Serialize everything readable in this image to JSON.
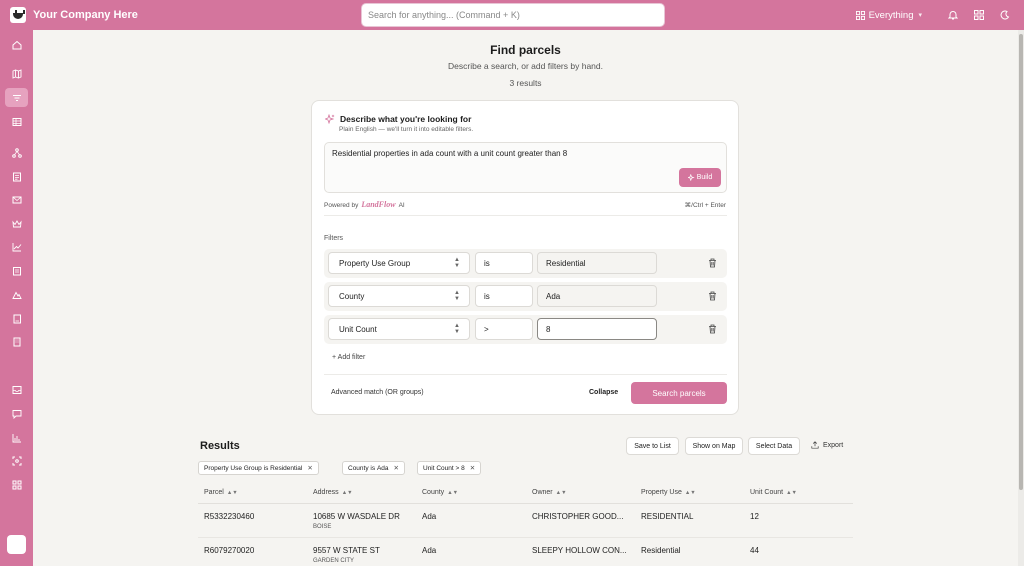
{
  "app": {
    "brand": "Your Company Here",
    "search_placeholder": "Search for anything... (Command + K)",
    "scope_label": "Everything",
    "accent_color": "#d4759d"
  },
  "sidebar": {
    "items": [
      {
        "icon": "home-icon"
      },
      {
        "icon": "map-icon"
      },
      {
        "icon": "filter-icon",
        "active": true
      },
      {
        "icon": "table-icon"
      },
      {
        "icon": "hierarchy-icon"
      },
      {
        "icon": "document-icon"
      },
      {
        "icon": "mail-icon"
      },
      {
        "icon": "crown-icon"
      },
      {
        "icon": "chart-line-icon"
      },
      {
        "icon": "clipboard-icon"
      },
      {
        "icon": "terrain-icon"
      },
      {
        "icon": "book-icon"
      },
      {
        "icon": "building-icon"
      },
      {
        "icon": "inbox-icon"
      },
      {
        "icon": "chat-icon"
      },
      {
        "icon": "bar-chart-icon"
      },
      {
        "icon": "scan-icon"
      },
      {
        "icon": "apps-icon"
      }
    ]
  },
  "page": {
    "title": "Find parcels",
    "subtitle": "Describe a search, or add filters by hand.",
    "results_count": "3 results"
  },
  "ai": {
    "title": "Describe what you're looking for",
    "subtitle": "Plain English — we'll turn it into editable filters.",
    "prompt": "Residential properties in ada count with a unit count greater than 8",
    "build_label": "Build",
    "powered_by": "Powered by",
    "powered_brand": "LandFlow",
    "powered_suffix": "AI",
    "shortcut": "⌘/Ctrl + Enter"
  },
  "filters": {
    "label": "Filters",
    "rows": [
      {
        "field": "Property Use Group",
        "operator": "is",
        "value": "Residential"
      },
      {
        "field": "County",
        "operator": "is",
        "value": "Ada"
      },
      {
        "field": "Unit Count",
        "operator": ">",
        "value": "8"
      }
    ],
    "add_label": "Add filter",
    "advanced_label": "Advanced match (OR groups)",
    "collapse_label": "Collapse",
    "search_label": "Search parcels"
  },
  "results": {
    "title": "Results",
    "actions": {
      "save": "Save to List",
      "show_map": "Show on Map",
      "select_data": "Select Data",
      "export": "Export"
    },
    "chips": [
      {
        "field": "Property Use Group",
        "op": "is",
        "value": "Residential"
      },
      {
        "field": "County",
        "op": "is",
        "value": "Ada"
      },
      {
        "field": "Unit Count",
        "op": ">",
        "value": "8"
      }
    ],
    "columns": [
      "Parcel",
      "Address",
      "County",
      "Owner",
      "Property Use",
      "Unit Count"
    ],
    "rows": [
      {
        "parcel": "R5332230460",
        "address": "10685 W WASDALE DR",
        "city": "BOISE",
        "county": "Ada",
        "owner": "CHRISTOPHER GOOD...",
        "use": "RESIDENTIAL",
        "units": "12"
      },
      {
        "parcel": "R6079270020",
        "address": "9557 W STATE ST",
        "city": "GARDEN CITY",
        "county": "Ada",
        "owner": "SLEEPY HOLLOW CON...",
        "use": "Residential",
        "units": "44"
      }
    ]
  }
}
